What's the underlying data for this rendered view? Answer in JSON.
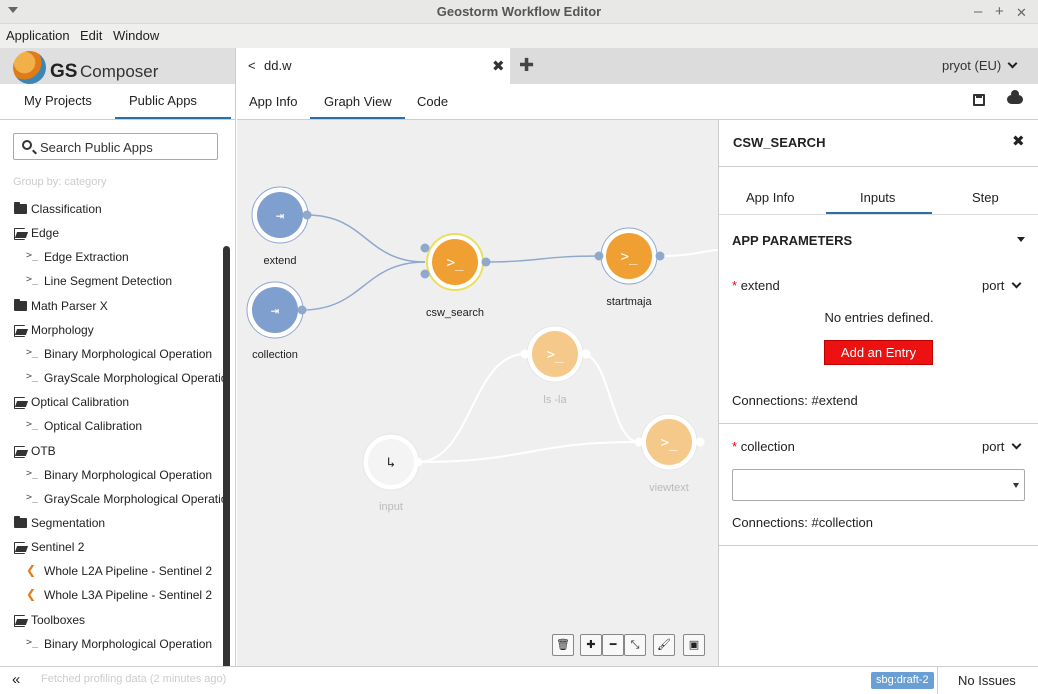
{
  "window": {
    "title": "Geostorm Workflow Editor",
    "minimize": "–",
    "maximize": "+",
    "close": "✕"
  },
  "menu": [
    "Application",
    "Edit",
    "Window"
  ],
  "brand": {
    "gs": "GS",
    "composer": "Composer"
  },
  "sidebar": {
    "tabs": [
      "My Projects",
      "Public Apps"
    ],
    "active_tab": "Public Apps",
    "search_placeholder": "Search Public Apps",
    "group_by": "Group by: category",
    "tree": [
      {
        "type": "folder",
        "label": "Classification"
      },
      {
        "type": "folder-open",
        "label": "Edge"
      },
      {
        "type": "app",
        "label": "Edge Extraction"
      },
      {
        "type": "app",
        "label": "Line Segment Detection"
      },
      {
        "type": "folder",
        "label": "Math Parser X"
      },
      {
        "type": "folder-open",
        "label": "Morphology"
      },
      {
        "type": "app",
        "label": "Binary Morphological Operation"
      },
      {
        "type": "app",
        "label": "GrayScale Morphological Operation"
      },
      {
        "type": "folder-open",
        "label": "Optical Calibration"
      },
      {
        "type": "app",
        "label": "Optical Calibration"
      },
      {
        "type": "folder-open",
        "label": "OTB"
      },
      {
        "type": "app",
        "label": "Binary Morphological Operation"
      },
      {
        "type": "app",
        "label": "GrayScale Morphological Operation"
      },
      {
        "type": "folder",
        "label": "Segmentation"
      },
      {
        "type": "folder-open",
        "label": "Sentinel 2"
      },
      {
        "type": "workflow",
        "label": "Whole L2A Pipeline - Sentinel 2"
      },
      {
        "type": "workflow",
        "label": "Whole L3A Pipeline - Sentinel 2"
      },
      {
        "type": "folder-open",
        "label": "Toolboxes"
      },
      {
        "type": "app",
        "label": "Binary Morphological Operation"
      }
    ]
  },
  "doc_tab": {
    "name": "dd.w",
    "close": "✖",
    "add": "✚"
  },
  "user": "pryot (EU)",
  "view_tabs": [
    "App Info",
    "Graph View",
    "Code"
  ],
  "active_view": "Graph View",
  "graph": {
    "nodes": [
      {
        "id": "extend",
        "label": "extend",
        "kind": "input",
        "faded": false
      },
      {
        "id": "collection",
        "label": "collection",
        "kind": "input",
        "faded": false
      },
      {
        "id": "csw_search",
        "label": "csw_search",
        "kind": "step",
        "faded": false,
        "selected": true
      },
      {
        "id": "startmaja",
        "label": "startmaja",
        "kind": "step",
        "faded": false
      },
      {
        "id": "ls",
        "label": "ls -la",
        "kind": "step",
        "faded": true
      },
      {
        "id": "input",
        "label": "input",
        "kind": "workflow-input",
        "faded": true
      },
      {
        "id": "viewtext",
        "label": "viewtext",
        "kind": "step",
        "faded": true
      }
    ],
    "edges": [
      [
        "extend",
        "csw_search"
      ],
      [
        "collection",
        "csw_search"
      ],
      [
        "csw_search",
        "startmaja"
      ],
      [
        "input",
        "ls"
      ],
      [
        "input",
        "viewtext"
      ],
      [
        "ls",
        "viewtext"
      ]
    ],
    "tools": [
      "trash-icon",
      "zoom-in-icon",
      "zoom-out-icon",
      "fit-icon",
      "brush-icon",
      "image-icon"
    ]
  },
  "panel": {
    "title": "CSW_SEARCH",
    "close": "✖",
    "tabs": [
      "App Info",
      "Inputs",
      "Step"
    ],
    "active_tab": "Inputs",
    "section": "APP PARAMETERS",
    "params": [
      {
        "name": "extend",
        "type": "port",
        "empty_text": "No entries defined.",
        "add_label": "Add an Entry",
        "connections": "Connections: #extend"
      },
      {
        "name": "collection",
        "type": "port",
        "connections": "Connections: #collection"
      }
    ]
  },
  "status": {
    "collapse": "«",
    "message": "Fetched profiling data (2 minutes ago)",
    "badge": "sbg:draft-2",
    "issues": "No Issues"
  },
  "colors": {
    "accent": "#2b6fa8",
    "node_blue": "#7f9fcf",
    "node_orange": "#f0a032",
    "danger": "#ee1111"
  }
}
